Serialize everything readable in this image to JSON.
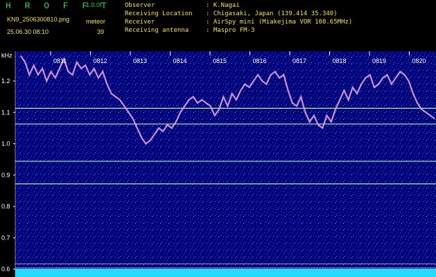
{
  "header": {
    "app_name": "H R O F F T",
    "version": "1.0.0f",
    "filename": "KN9_2506300810.png",
    "mode_label": "meteor",
    "timestamp": "25.06.30 08:10",
    "count": "39",
    "observer_label": "Observer",
    "observer_value": ": K.Nagai",
    "location_label": "Receiving Location",
    "location_value": ": Chigasaki, Japan (139.414 35.340)",
    "receiver_label": "Receiver",
    "receiver_value": ": AirSpy mini (Miakejima VOR 108.65MHz)",
    "antenna_label": "Receiving antenna",
    "antenna_value": ": Maspro FM-3"
  },
  "colors": {
    "background": "#000000",
    "header_yellow": "#f2e34a",
    "app_green": "#35d24a",
    "waterfall_base": "#00047a",
    "noise_floor": "#25d9ff",
    "carrier_line": "#a9f3b8",
    "doppler_trace": "#e58bd6"
  },
  "chart_data": {
    "type": "heatmap",
    "title": "",
    "ylabel": "kHz",
    "xlabel": "",
    "ylim": [
      0.575,
      1.295
    ],
    "y_ticks": [
      {
        "value": 1.2,
        "label": "1.2"
      },
      {
        "value": 1.1,
        "label": "1.1"
      },
      {
        "value": 1.0,
        "label": "1.0"
      },
      {
        "value": 0.9,
        "label": "0.9"
      },
      {
        "value": 0.8,
        "label": "0.8"
      },
      {
        "value": 0.7,
        "label": "0.7"
      },
      {
        "value": 0.6,
        "label": "0.6"
      }
    ],
    "time_minutes": [
      "0811",
      "0812",
      "0813",
      "0814",
      "0815",
      "0816",
      "0817",
      "0818",
      "0819",
      "0820"
    ],
    "horizontal_lines_khz": [
      1.113,
      1.063,
      0.944,
      0.872,
      0.617,
      0.604,
      0.594
    ],
    "doppler_trace": [
      [
        0.0,
        1.28
      ],
      [
        0.2,
        1.26
      ],
      [
        0.4,
        1.22
      ],
      [
        0.6,
        1.25
      ],
      [
        0.8,
        1.22
      ],
      [
        1.0,
        1.24
      ],
      [
        1.2,
        1.2
      ],
      [
        1.4,
        1.23
      ],
      [
        1.6,
        1.21
      ],
      [
        1.8,
        1.24
      ],
      [
        2.0,
        1.27
      ],
      [
        2.2,
        1.23
      ],
      [
        2.4,
        1.22
      ],
      [
        2.6,
        1.26
      ],
      [
        2.8,
        1.24
      ],
      [
        3.0,
        1.25
      ],
      [
        3.2,
        1.22
      ],
      [
        3.4,
        1.24
      ],
      [
        3.6,
        1.21
      ],
      [
        3.8,
        1.23
      ],
      [
        4.0,
        1.19
      ],
      [
        4.2,
        1.16
      ],
      [
        4.4,
        1.15
      ],
      [
        4.6,
        1.14
      ],
      [
        4.8,
        1.12
      ],
      [
        5.0,
        1.1
      ],
      [
        5.2,
        1.08
      ],
      [
        5.4,
        1.05
      ],
      [
        5.6,
        1.02
      ],
      [
        5.8,
        1.0
      ],
      [
        6.0,
        1.01
      ],
      [
        6.2,
        1.03
      ],
      [
        6.4,
        1.05
      ],
      [
        6.6,
        1.04
      ],
      [
        6.8,
        1.06
      ],
      [
        7.0,
        1.05
      ],
      [
        7.2,
        1.07
      ],
      [
        7.4,
        1.1
      ],
      [
        7.6,
        1.12
      ],
      [
        7.8,
        1.14
      ],
      [
        8.0,
        1.15
      ],
      [
        8.2,
        1.13
      ],
      [
        8.4,
        1.14
      ],
      [
        8.6,
        1.13
      ],
      [
        8.8,
        1.12
      ],
      [
        9.0,
        1.09
      ],
      [
        9.2,
        1.11
      ],
      [
        9.4,
        1.15
      ],
      [
        9.6,
        1.12
      ],
      [
        9.8,
        1.16
      ],
      [
        10.0,
        1.14
      ],
      [
        10.2,
        1.17
      ],
      [
        10.4,
        1.19
      ],
      [
        10.6,
        1.18
      ],
      [
        10.8,
        1.2
      ],
      [
        11.0,
        1.22
      ],
      [
        11.2,
        1.2
      ],
      [
        11.4,
        1.19
      ],
      [
        11.6,
        1.22
      ],
      [
        11.8,
        1.23
      ],
      [
        12.0,
        1.21
      ],
      [
        12.2,
        1.22
      ],
      [
        12.4,
        1.17
      ],
      [
        12.6,
        1.13
      ],
      [
        12.8,
        1.12
      ],
      [
        13.0,
        1.15
      ],
      [
        13.2,
        1.1
      ],
      [
        13.4,
        1.07
      ],
      [
        13.6,
        1.09
      ],
      [
        13.8,
        1.06
      ],
      [
        14.0,
        1.05
      ],
      [
        14.2,
        1.09
      ],
      [
        14.4,
        1.07
      ],
      [
        14.6,
        1.11
      ],
      [
        14.8,
        1.14
      ],
      [
        15.0,
        1.17
      ],
      [
        15.2,
        1.14
      ],
      [
        15.4,
        1.18
      ],
      [
        15.6,
        1.16
      ],
      [
        15.8,
        1.19
      ],
      [
        16.0,
        1.21
      ],
      [
        16.2,
        1.22
      ],
      [
        16.4,
        1.18
      ],
      [
        16.6,
        1.19
      ],
      [
        16.8,
        1.21
      ],
      [
        17.0,
        1.22
      ],
      [
        17.2,
        1.19
      ],
      [
        17.4,
        1.21
      ],
      [
        17.6,
        1.23
      ],
      [
        17.8,
        1.22
      ],
      [
        18.0,
        1.2
      ],
      [
        18.2,
        1.16
      ],
      [
        18.4,
        1.13
      ],
      [
        18.6,
        1.11
      ],
      [
        18.8,
        1.1
      ],
      [
        19.0,
        1.09
      ],
      [
        19.2,
        1.08
      ]
    ]
  }
}
